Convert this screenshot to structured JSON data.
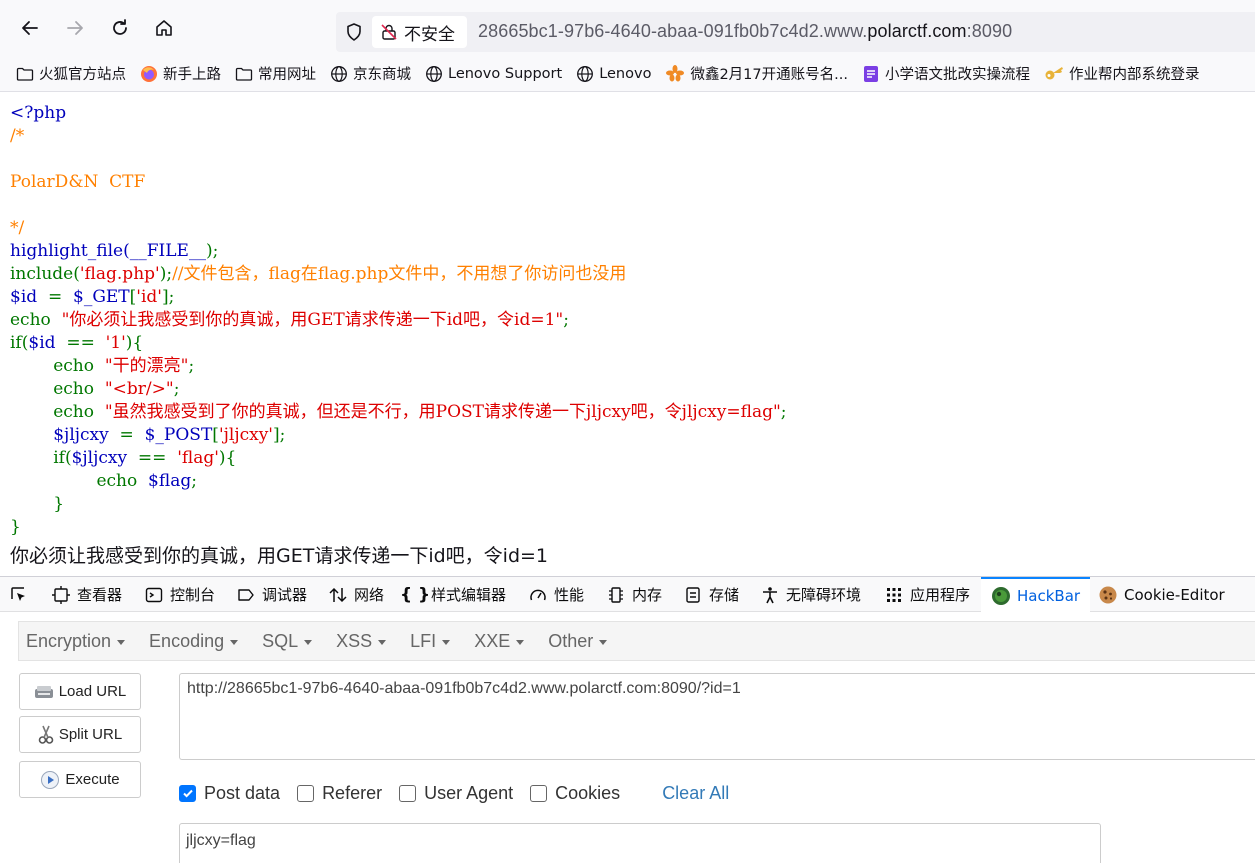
{
  "browser": {
    "security_label": "不安全",
    "url_prefix": "28665bc1-97b6-4640-abaa-091fb0b7c4d2.www.",
    "url_host": "polarctf.com",
    "url_port": ":8090"
  },
  "bookmarks": [
    {
      "label": "火狐官方站点",
      "icon": "folder-icon"
    },
    {
      "label": "新手上路",
      "icon": "firefox-icon"
    },
    {
      "label": "常用网址",
      "icon": "folder-icon"
    },
    {
      "label": "京东商城",
      "icon": "globe-icon"
    },
    {
      "label": "Lenovo Support",
      "icon": "globe-icon"
    },
    {
      "label": "Lenovo",
      "icon": "globe-icon"
    },
    {
      "label": "微鑫2月17开通账号名...",
      "icon": "leaf-icon"
    },
    {
      "label": "小学语文批改实操流程",
      "icon": "doc-icon"
    },
    {
      "label": "作业帮内部系统登录",
      "icon": "key-icon"
    }
  ],
  "source": {
    "l1": "<?php",
    "l2": "/*",
    "l3": "",
    "l4": "PolarD&N  CTF",
    "l5": "",
    "l6": "*/",
    "l7a": "highlight_file(",
    "l7b": "__FILE__",
    "l7c": ");",
    "l8a": "include(",
    "l8b": "'flag.php'",
    "l8c": ");",
    "l8d": "//文件包含，flag在flag.php文件中，不用想了你访问也没用",
    "l9a": "$id",
    "l9b": "  =  ",
    "l9c": "$_GET",
    "l9d": "[",
    "l9e": "'id'",
    "l9f": "];",
    "l10a": "echo  ",
    "l10b": "\"你必须让我感受到你的真诚，用GET请求传递一下id吧，令id=1\"",
    "l10c": ";",
    "l11a": "if(",
    "l11b": "$id",
    "l11c": "  ==  ",
    "l11d": "'1'",
    "l11e": "){",
    "l12a": "        echo  ",
    "l12b": "\"干的漂亮\"",
    "l12c": ";",
    "l13a": "        echo  ",
    "l13b": "\"<br/>\"",
    "l13c": ";",
    "l14a": "        echo  ",
    "l14b": "\"虽然我感受到了你的真诚，但还是不行，用POST请求传递一下jljcxy吧，令jljcxy=flag\"",
    "l14c": ";",
    "l15a": "        ",
    "l15b": "$jljcxy",
    "l15c": "  =  ",
    "l15d": "$_POST",
    "l15e": "[",
    "l15f": "'jljcxy'",
    "l15g": "];",
    "l16a": "        if(",
    "l16b": "$jljcxy",
    "l16c": "  ==  ",
    "l16d": "'flag'",
    "l16e": "){",
    "l17a": "                echo  ",
    "l17b": "$flag",
    "l17c": ";",
    "l18": "        }",
    "l19": "}"
  },
  "output": "你必须让我感受到你的真诚，用GET请求传递一下id吧，令id=1",
  "devtools": {
    "tabs": [
      "查看器",
      "控制台",
      "调试器",
      "网络",
      "样式编辑器",
      "性能",
      "内存",
      "存储",
      "无障碍环境",
      "应用程序",
      "HackBar",
      "Cookie-Editor"
    ]
  },
  "hackbar": {
    "menu": [
      "Encryption",
      "Encoding",
      "SQL",
      "XSS",
      "LFI",
      "XXE",
      "Other"
    ],
    "load_url": "Load URL",
    "split_url": "Split URL",
    "execute": "Execute",
    "url_value": "http://28665bc1-97b6-4640-abaa-091fb0b7c4d2.www.polarctf.com:8090/?id=1",
    "options": {
      "post_data": "Post data",
      "referer": "Referer",
      "user_agent": "User Agent",
      "cookies": "Cookies"
    },
    "options_checked": {
      "post_data": true,
      "referer": false,
      "user_agent": false,
      "cookies": false
    },
    "clear_all": "Clear All",
    "post_value": "jljcxy=flag"
  },
  "colors": {
    "accent": "#0060df",
    "php_default": "#0000bb",
    "php_comment": "#ff8000",
    "php_keyword": "#007700",
    "php_string": "#dd0000"
  }
}
